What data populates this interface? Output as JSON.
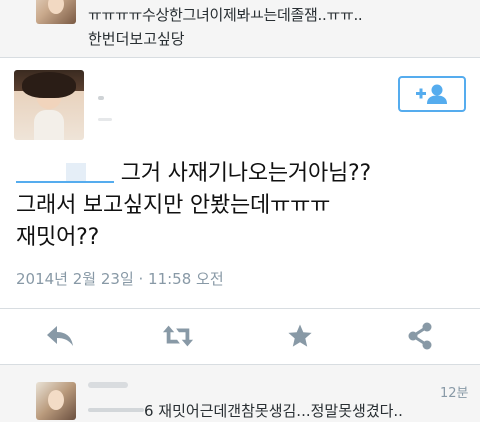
{
  "top_tweet": {
    "text_line1": "ㅠㅠㅠㅠ수상한그녀이제봐ㅛ는데졸잼..ㅠㅠ..",
    "text_line2": "한번더보고싶당"
  },
  "main_tweet": {
    "follow_icon": "add-user-icon",
    "text_line1_rest": " 그거 사재기나오는거아님??",
    "text_line2": "그래서 보고싶지만 안봤는데ㅠㅠㅠ",
    "text_line3": "재밋어??",
    "timestamp": "2014년 2월 23일 · 11:58 오전",
    "actions": [
      {
        "name": "reply",
        "icon": "reply-icon"
      },
      {
        "name": "retweet",
        "icon": "retweet-icon"
      },
      {
        "name": "favorite",
        "icon": "star-icon"
      },
      {
        "name": "share",
        "icon": "share-icon"
      }
    ]
  },
  "bottom_tweet": {
    "time": "12분",
    "text_suffix": "6 재밋어근데갠참못생김...정말못생겼다.."
  },
  "colors": {
    "accent": "#55acee",
    "icon_gray": "#8899a6",
    "muted_text": "#8899a6"
  }
}
